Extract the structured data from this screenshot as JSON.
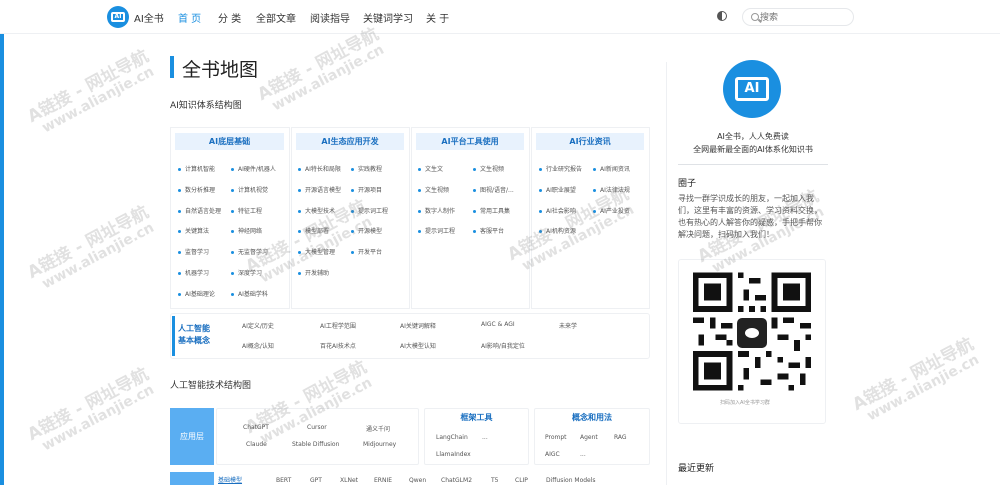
{
  "header": {
    "brand": "AI全书",
    "logo_text": "AI",
    "nav": [
      "首 页",
      "分 类",
      "全部文章",
      "阅读指导",
      "关键词学习",
      "关 于"
    ],
    "active_nav": 0,
    "search_placeholder": "搜索"
  },
  "main": {
    "title": "全书地图",
    "section1": "AI知识体系结构图",
    "section2": "人工智能技术结构图",
    "knowledge_columns": [
      {
        "header": "AI底层基础",
        "items": [
          "计算机智能",
          "AI硬件/机器人",
          "数分析推理",
          "计算机视觉",
          "自然语言处理",
          "特征工程",
          "关键算法",
          "神经网络",
          "监督学习",
          "无监督学习",
          "机器学习",
          "深度学习",
          "AI基础理论",
          "AI基础学科"
        ]
      },
      {
        "header": "AI生态应用开发",
        "items": [
          "AI特长和局限",
          "实践教程",
          "开源语言模型",
          "开源项目",
          "大模型技术",
          "提示词工程",
          "模型部署",
          "开源模型",
          "大模型管理",
          "开发平台",
          "开发辅助"
        ]
      },
      {
        "header": "AI平台工具使用",
        "items": [
          "文生文",
          "文生视频",
          "文生视频",
          "图视/语音/...",
          "数字人制作",
          "常用工具集",
          "提示词工程",
          "客服平台"
        ]
      },
      {
        "header": "AI行业资讯",
        "items": [
          "行业研究报告",
          "AI新闻资讯",
          "AI职业展望",
          "AI法律法规",
          "AI社会影响",
          "AI产业投资",
          "AI机构资源"
        ]
      }
    ],
    "concepts": {
      "label": "人工智能基本概念",
      "items": [
        "AI定义/历史",
        "AI工程学范围",
        "AI关键词解释",
        "AIGC & AGI",
        "未来学",
        "AI概念/认知",
        "百花AI技术点",
        "AI大模型认知",
        "AI影响/自我定位"
      ]
    },
    "tech": {
      "app_layer": "应用层",
      "apps": [
        "ChatGPT",
        "Cursor",
        "通义千问",
        "Claude",
        "Stable Diffusion",
        "Midjourney"
      ],
      "tools_header": "框架工具",
      "tools": [
        "LangChain",
        "...",
        "LlamaIndex"
      ],
      "concepts_header": "概念和用法",
      "concept_items": [
        "Prompt",
        "Agent",
        "RAG",
        "AIGC",
        "..."
      ],
      "base_tab": "基础模型",
      "models": [
        "BERT",
        "GPT",
        "XLNet",
        "ERNIE",
        "Qwen",
        "ChatGLM2",
        "T5",
        "CLIP",
        "Diffusion Models"
      ]
    }
  },
  "sidebar": {
    "logo_text": "AI",
    "tagline1": "AI全书，人人免费读",
    "tagline2": "全网最新最全面的AI体系化知识书",
    "circle_title": "圈子",
    "circle_text": "寻找一群学识成长的朋友，一起加入我们，这里有丰富的资源、学习资料交换，也有热心的人解答你的疑惑，手把手帮你解决问题，扫码加入我们！",
    "qr_caption": "扫码加入AI全书学习群",
    "latest_title": "最近更新"
  },
  "watermark": "A链接 - 网址导航",
  "watermark_url": "www.alianjie.cn"
}
